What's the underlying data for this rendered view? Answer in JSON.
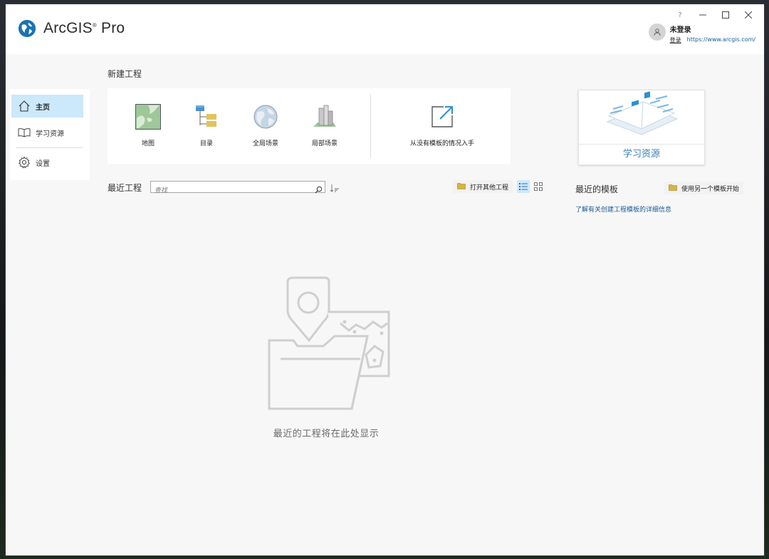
{
  "app": {
    "title_main": "ArcGIS",
    "title_reg": "®",
    "title_suffix": " Pro"
  },
  "window_controls": {
    "help": "?",
    "minimize": "—",
    "maximize": "☐",
    "close": "✕"
  },
  "user": {
    "status": "未登录",
    "login_link": "登录",
    "portal_url": "https://www.arcgis.com/"
  },
  "sidebar": {
    "items": [
      {
        "label": "主页",
        "icon": "home-icon",
        "active": true
      },
      {
        "label": "学习资源",
        "icon": "book-icon",
        "active": false
      },
      {
        "label": "设置",
        "icon": "gear-icon",
        "active": false
      }
    ]
  },
  "new_project": {
    "title": "新建工程",
    "items": [
      {
        "label": "地图",
        "icon": "map-icon"
      },
      {
        "label": "目录",
        "icon": "catalog-icon"
      },
      {
        "label": "全局场景",
        "icon": "global-scene-icon"
      },
      {
        "label": "局部场景",
        "icon": "local-scene-icon"
      },
      {
        "label": "从没有模板的情况入手",
        "icon": "start-without-template-icon"
      }
    ]
  },
  "learn_card": {
    "label": "学习资源"
  },
  "recent_projects": {
    "title": "最近工程",
    "search_placeholder": "查找",
    "open_other_label": "打开其他工程",
    "empty_message": "最近的工程将在此处显示"
  },
  "recent_templates": {
    "title": "最近的模板",
    "use_other_label": "使用另一个模板开始",
    "learn_more_link": "了解有关创建工程模板的详细信息"
  },
  "colors": {
    "accent": "#1a73b3",
    "selected_bg": "#cce8fb",
    "link": "#1a5a96",
    "folder": "#d9b43c"
  }
}
